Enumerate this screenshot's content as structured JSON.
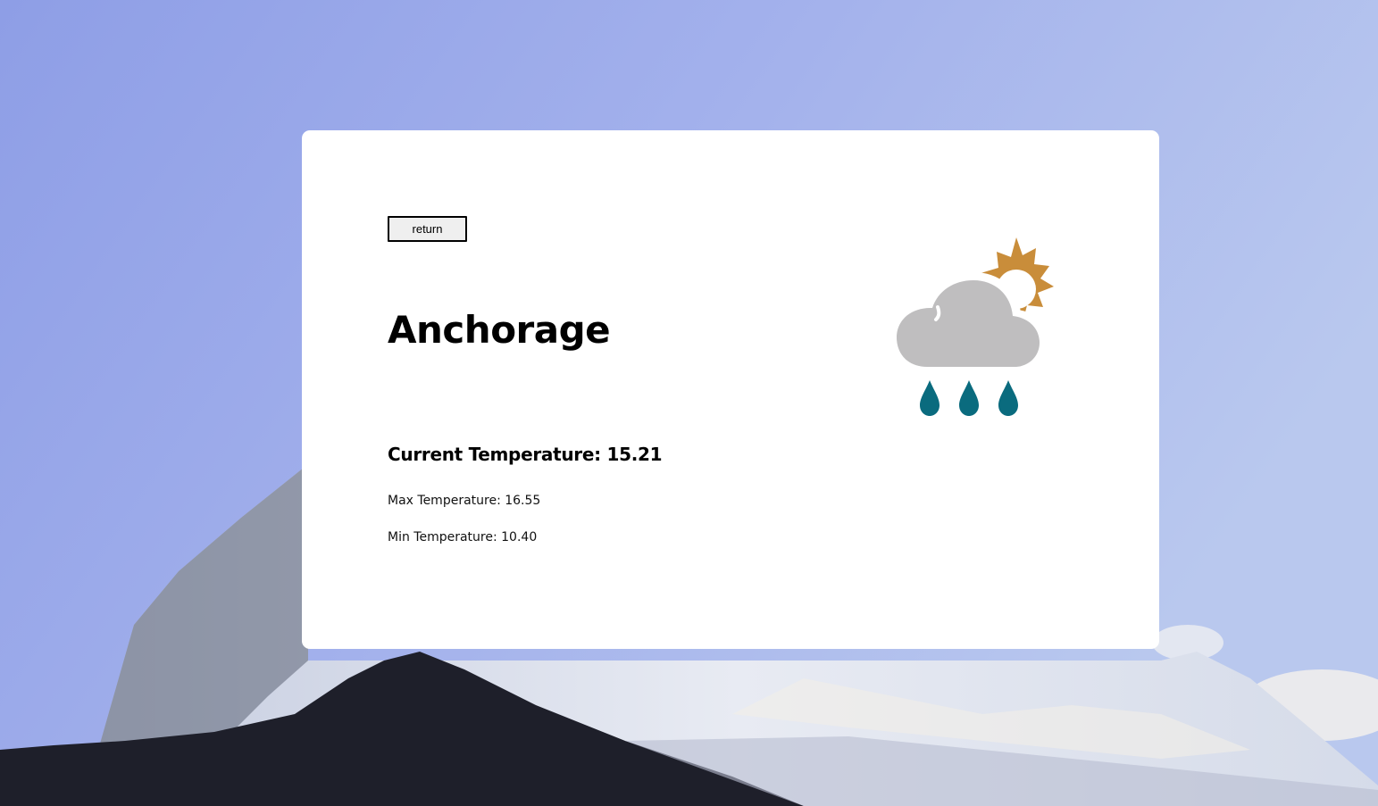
{
  "return_button": {
    "label": "return"
  },
  "weather": {
    "city": "Anchorage",
    "current_temperature": "Current Temperature: 15.21",
    "max_temperature": "Max Temperature: 16.55",
    "min_temperature": "Min Temperature: 10.40",
    "icon": "partly-cloudy-rain-icon"
  },
  "colors": {
    "sun": "#c98d3a",
    "cloud": "#bfbebf",
    "rain": "#0a6b7e",
    "card": "#ffffff"
  }
}
